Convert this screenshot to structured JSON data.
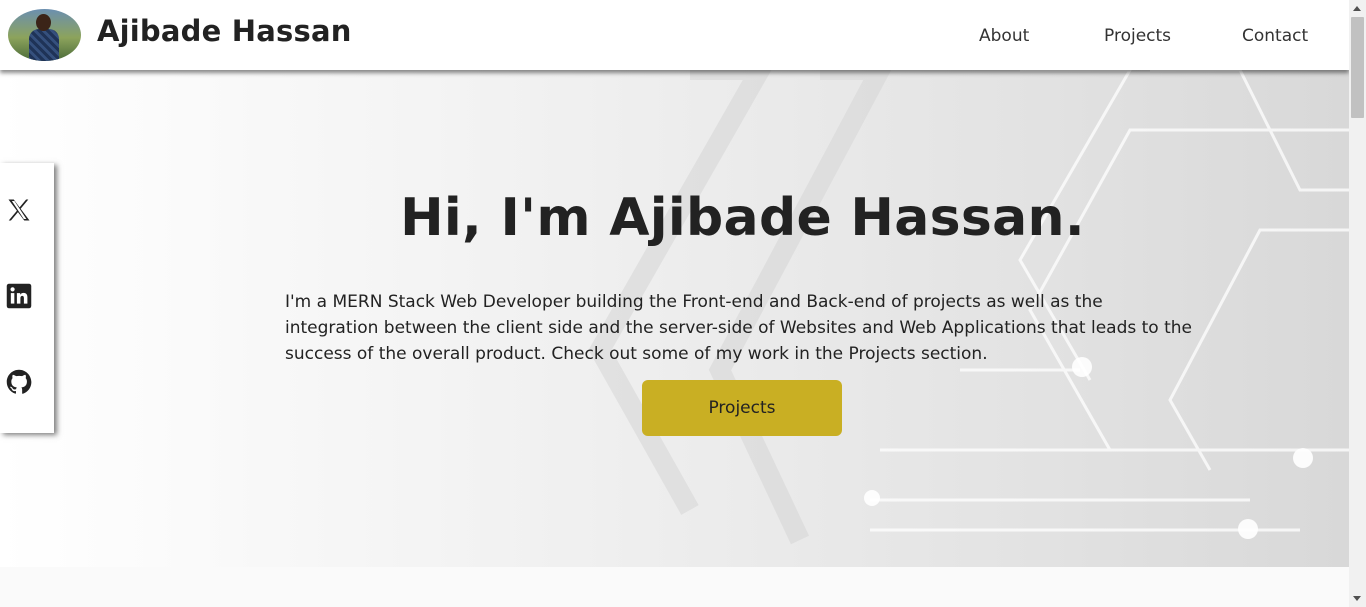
{
  "header": {
    "site_title": "Ajibade Hassan",
    "nav": [
      {
        "label": "About"
      },
      {
        "label": "Projects"
      },
      {
        "label": "Contact"
      }
    ]
  },
  "hero": {
    "heading": "Hi, I'm Ajibade Hassan.",
    "intro": "I'm a MERN Stack Web Developer building the Front-end and Back-end of projects as well as the integration between the client side and the server-side of Websites and Web Applications that leads to the success of the overall product. Check out some of my work in the Projects section.",
    "cta_label": "Projects",
    "cta_color": "#c9af23"
  },
  "social": [
    {
      "icon": "x-twitter-icon"
    },
    {
      "icon": "linkedin-icon"
    },
    {
      "icon": "github-icon"
    }
  ]
}
